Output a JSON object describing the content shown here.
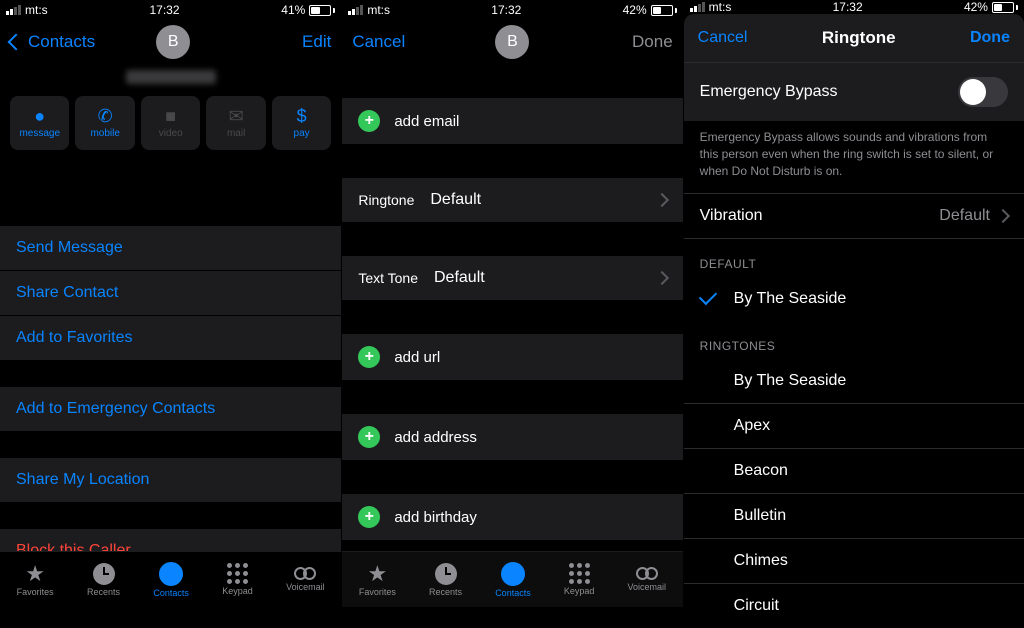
{
  "status": {
    "carrier": "mt:s",
    "time": "17:32",
    "bat1": "41%",
    "bat2": "42%",
    "bat3": "42%",
    "fill1": 41,
    "fill2": 42,
    "fill3": 42
  },
  "p1": {
    "back": "Contacts",
    "edit": "Edit",
    "avatar": "B",
    "quick": {
      "message": "message",
      "mobile": "mobile",
      "video": "video",
      "mail": "mail",
      "pay": "pay"
    },
    "actions": {
      "send": "Send Message",
      "share": "Share Contact",
      "fav": "Add to Favorites",
      "emergency": "Add to Emergency Contacts",
      "location": "Share My Location",
      "block": "Block this Caller"
    }
  },
  "p2": {
    "cancel": "Cancel",
    "done": "Done",
    "avatar": "B",
    "add_email": "add email",
    "ringtone_label": "Ringtone",
    "ringtone_value": "Default",
    "texttone_label": "Text Tone",
    "texttone_value": "Default",
    "add_url": "add url",
    "add_address": "add address",
    "add_birthday": "add birthday"
  },
  "p3": {
    "cancel": "Cancel",
    "title": "Ringtone",
    "done": "Done",
    "bypass_label": "Emergency Bypass",
    "bypass_desc": "Emergency Bypass allows sounds and vibrations from this person even when the ring switch is set to silent, or when Do Not Disturb is on.",
    "vibration_label": "Vibration",
    "vibration_value": "Default",
    "section_default": "DEFAULT",
    "selected": "By The Seaside",
    "section_ringtones": "RINGTONES",
    "ringtones": [
      "By The Seaside",
      "Apex",
      "Beacon",
      "Bulletin",
      "Chimes",
      "Circuit"
    ]
  },
  "tabs": {
    "favorites": "Favorites",
    "recents": "Recents",
    "contacts": "Contacts",
    "keypad": "Keypad",
    "voicemail": "Voicemail"
  }
}
